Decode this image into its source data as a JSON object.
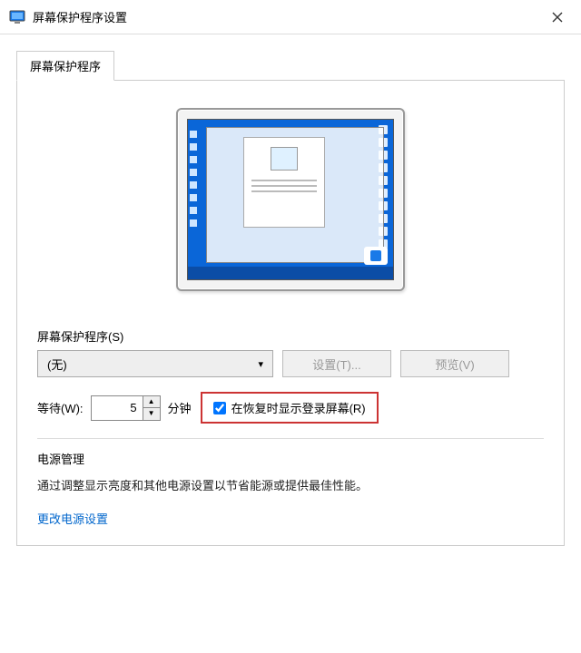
{
  "window": {
    "title": "屏幕保护程序设置"
  },
  "tab": {
    "label": "屏幕保护程序"
  },
  "screensaver": {
    "group_label": "屏幕保护程序(S)",
    "dropdown_value": "(无)",
    "settings_btn": "设置(T)...",
    "preview_btn": "预览(V)",
    "wait_label": "等待(W):",
    "wait_value": "5",
    "minutes_label": "分钟",
    "resume_label": "在恢复时显示登录屏幕(R)"
  },
  "power": {
    "title": "电源管理",
    "desc": "通过调整显示亮度和其他电源设置以节省能源或提供最佳性能。",
    "link": "更改电源设置"
  }
}
